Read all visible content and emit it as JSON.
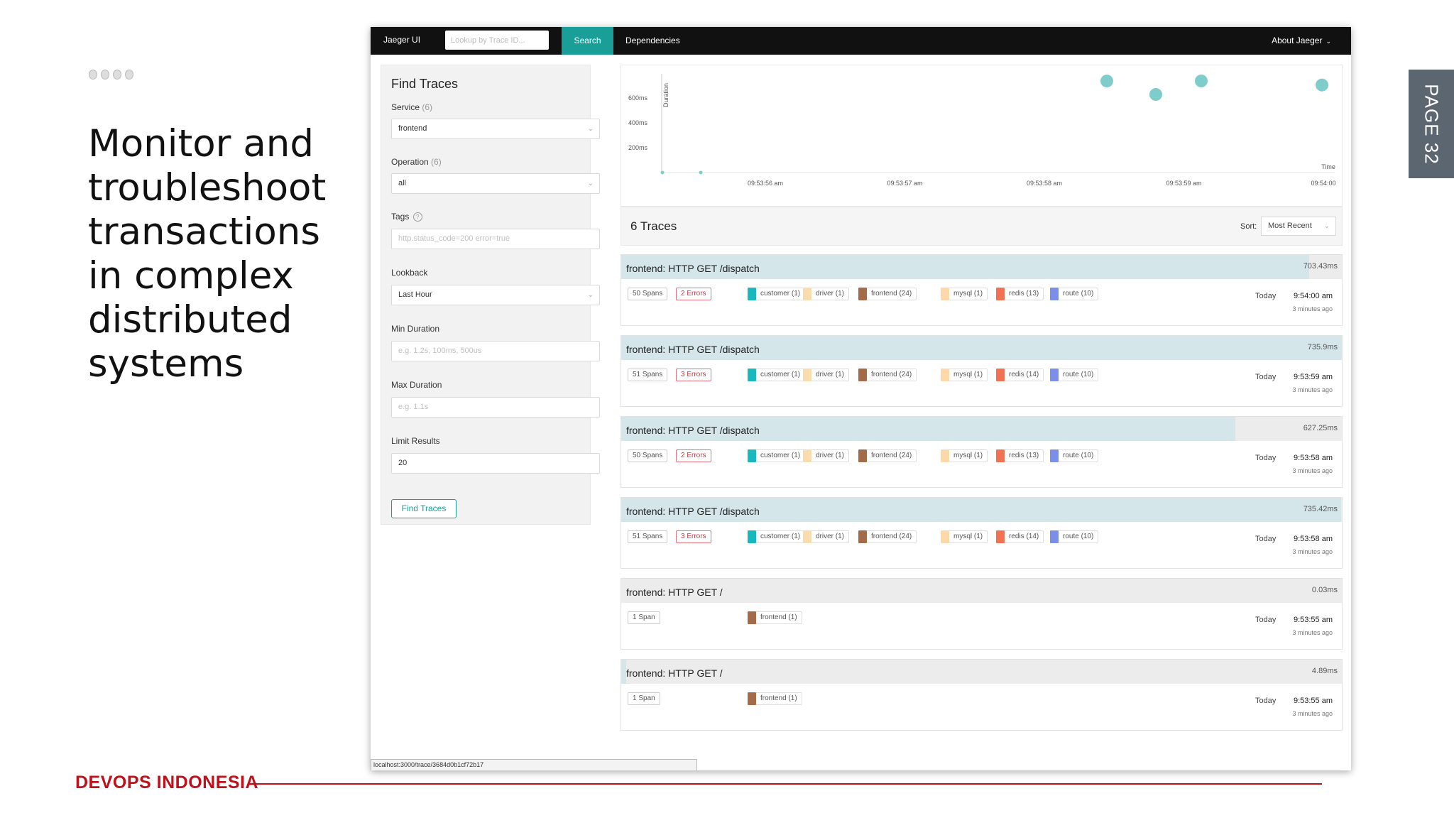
{
  "slide": {
    "headline": "Monitor and troubleshoot transactions in complex distributed systems",
    "page_label": "PAGE 32",
    "brand": "DEVOPS INDONESIA",
    "accent_color": "#c0101a"
  },
  "nav": {
    "brand": "Jaeger UI",
    "lookup_placeholder": "Lookup by Trace ID...",
    "search": "Search",
    "dependencies": "Dependencies",
    "about": "About Jaeger",
    "active_color": "#199e98"
  },
  "find": {
    "title": "Find Traces",
    "service_label": "Service",
    "service_count": "(6)",
    "service_value": "frontend",
    "operation_label": "Operation",
    "operation_count": "(6)",
    "operation_value": "all",
    "tags_label": "Tags",
    "tags_placeholder": "http.status_code=200 error=true",
    "lookback_label": "Lookback",
    "lookback_value": "Last Hour",
    "min_label": "Min Duration",
    "min_placeholder": "e.g. 1.2s, 100ms, 500us",
    "max_label": "Max Duration",
    "max_placeholder": "e.g. 1.1s",
    "limit_label": "Limit Results",
    "limit_value": "20",
    "button": "Find Traces"
  },
  "chart_data": {
    "type": "scatter",
    "ylabel": "Duration",
    "xlabel": "Time",
    "y_ticks": [
      "200ms",
      "400ms",
      "600ms"
    ],
    "x_ticks": [
      "09:53:56 am",
      "09:53:57 am",
      "09:53:58 am",
      "09:53:59 am",
      "09:54:00"
    ],
    "ylim": [
      0,
      735.9
    ],
    "points": [
      {
        "x": "09:53:55 am",
        "y": 0.03
      },
      {
        "x": "09:53:55 am",
        "y": 4.89
      },
      {
        "x": "09:53:58 am",
        "y": 735.42
      },
      {
        "x": "09:53:58 am",
        "y": 627.25
      },
      {
        "x": "09:53:59 am",
        "y": 735.9
      },
      {
        "x": "09:54:00 am",
        "y": 703.43
      }
    ],
    "color": "#7fcdcb"
  },
  "results": {
    "count_label": "6 Traces",
    "sort_label": "Sort:",
    "sort_value": "Most Recent"
  },
  "service_colors": {
    "customer": "#17b8be",
    "driver": "#f8dcad",
    "frontend": "#a36b49",
    "mysql": "#fed8a8",
    "redis": "#f37153",
    "route": "#7b8ee8"
  },
  "traces": [
    {
      "name": "frontend: HTTP GET /dispatch",
      "duration": "703.43ms",
      "duration_fraction": 0.955,
      "spans": "50 Spans",
      "errors": "2 Errors",
      "services": [
        {
          "key": "customer",
          "label": "customer (1)"
        },
        {
          "key": "driver",
          "label": "driver (1)"
        },
        {
          "key": "frontend",
          "label": "frontend (24)"
        },
        {
          "key": "mysql",
          "label": "mysql (1)"
        },
        {
          "key": "redis",
          "label": "redis (13)"
        },
        {
          "key": "route",
          "label": "route (10)"
        }
      ],
      "day": "Today",
      "time": "9:54:00 am",
      "ago": "3 minutes ago"
    },
    {
      "name": "frontend: HTTP GET /dispatch",
      "duration": "735.9ms",
      "duration_fraction": 1.0,
      "spans": "51 Spans",
      "errors": "3 Errors",
      "services": [
        {
          "key": "customer",
          "label": "customer (1)"
        },
        {
          "key": "driver",
          "label": "driver (1)"
        },
        {
          "key": "frontend",
          "label": "frontend (24)"
        },
        {
          "key": "mysql",
          "label": "mysql (1)"
        },
        {
          "key": "redis",
          "label": "redis (14)"
        },
        {
          "key": "route",
          "label": "route (10)"
        }
      ],
      "day": "Today",
      "time": "9:53:59 am",
      "ago": "3 minutes ago"
    },
    {
      "name": "frontend: HTTP GET /dispatch",
      "duration": "627.25ms",
      "duration_fraction": 0.852,
      "spans": "50 Spans",
      "errors": "2 Errors",
      "services": [
        {
          "key": "customer",
          "label": "customer (1)"
        },
        {
          "key": "driver",
          "label": "driver (1)"
        },
        {
          "key": "frontend",
          "label": "frontend (24)"
        },
        {
          "key": "mysql",
          "label": "mysql (1)"
        },
        {
          "key": "redis",
          "label": "redis (13)"
        },
        {
          "key": "route",
          "label": "route (10)"
        }
      ],
      "day": "Today",
      "time": "9:53:58 am",
      "ago": "3 minutes ago"
    },
    {
      "name": "frontend: HTTP GET /dispatch",
      "duration": "735.42ms",
      "duration_fraction": 0.999,
      "spans": "51 Spans",
      "errors": "3 Errors",
      "services": [
        {
          "key": "customer",
          "label": "customer (1)"
        },
        {
          "key": "driver",
          "label": "driver (1)"
        },
        {
          "key": "frontend",
          "label": "frontend (24)"
        },
        {
          "key": "mysql",
          "label": "mysql (1)"
        },
        {
          "key": "redis",
          "label": "redis (14)"
        },
        {
          "key": "route",
          "label": "route (10)"
        }
      ],
      "day": "Today",
      "time": "9:53:58 am",
      "ago": "3 minutes ago"
    },
    {
      "name": "frontend: HTTP GET /",
      "duration": "0.03ms",
      "duration_fraction": 0.0,
      "spans": "1 Span",
      "errors": "",
      "services": [
        {
          "key": "frontend",
          "label": "frontend (1)"
        }
      ],
      "day": "Today",
      "time": "9:53:55 am",
      "ago": "3 minutes ago"
    },
    {
      "name": "frontend: HTTP GET /",
      "duration": "4.89ms",
      "duration_fraction": 0.007,
      "spans": "1 Span",
      "errors": "",
      "services": [
        {
          "key": "frontend",
          "label": "frontend (1)"
        }
      ],
      "day": "Today",
      "time": "9:53:55 am",
      "ago": "3 minutes ago"
    }
  ],
  "status_url": "localhost:3000/trace/3684d0b1cf72b17"
}
